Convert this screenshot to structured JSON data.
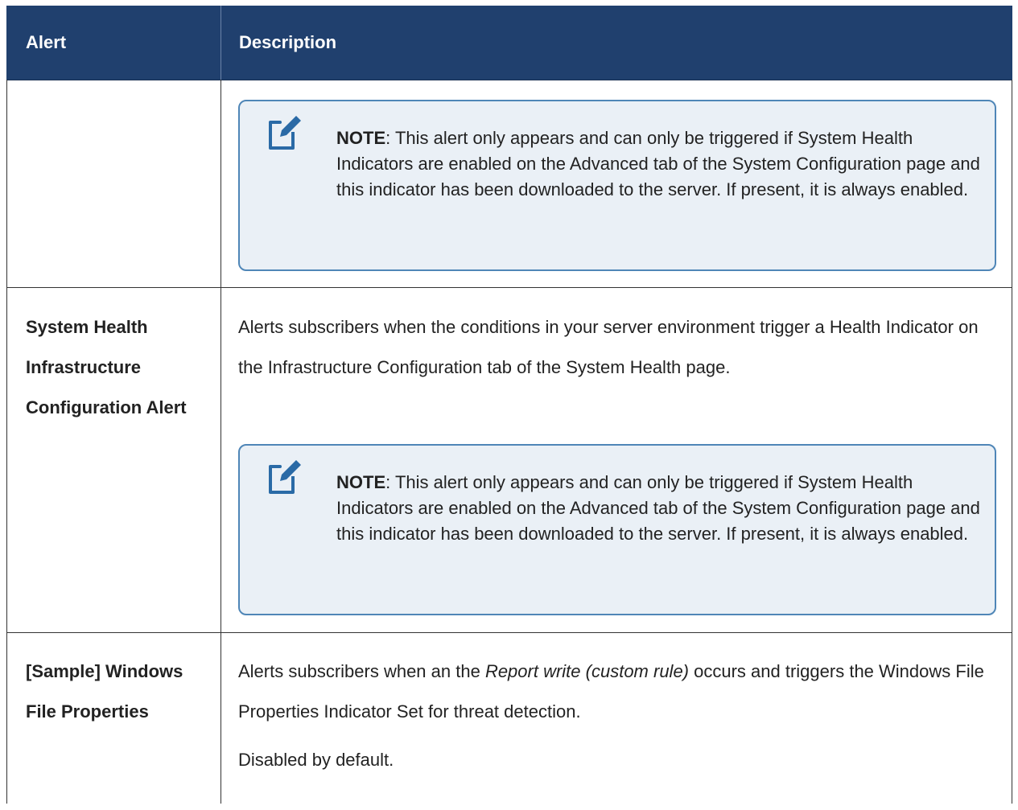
{
  "table": {
    "headers": {
      "alert": "Alert",
      "description": "Description"
    },
    "note_icon": "note-pencil-icon",
    "rows": [
      {
        "note": {
          "label": "NOTE",
          "text": ":  This alert only appears and can only be triggered if System Health Indicators are enabled on the Advanced tab of the System Configuration page and this indicator has been downloaded to the server. If present, it is always enabled."
        }
      },
      {
        "alert_name": "System Health Infrastructure Configuration Alert",
        "description": "Alerts subscribers when the conditions in your server environment trigger a Health Indicator on the Infrastructure Configuration tab of the System Health page.",
        "note": {
          "label": "NOTE",
          "text": ":  This alert only appears and can only be triggered if System Health Indicators are enabled on the Advanced tab of the System Configuration page and this indicator has been downloaded to the server. If present, it is always enabled."
        }
      },
      {
        "alert_name": "[Sample] Windows File Properties",
        "description_pre": "Alerts subscribers when an the ",
        "description_italic": "Report write (custom rule)",
        "description_post": " occurs and triggers the Windows File Properties Indicator Set for threat detection.",
        "description_extra": "Disabled by default."
      }
    ]
  }
}
